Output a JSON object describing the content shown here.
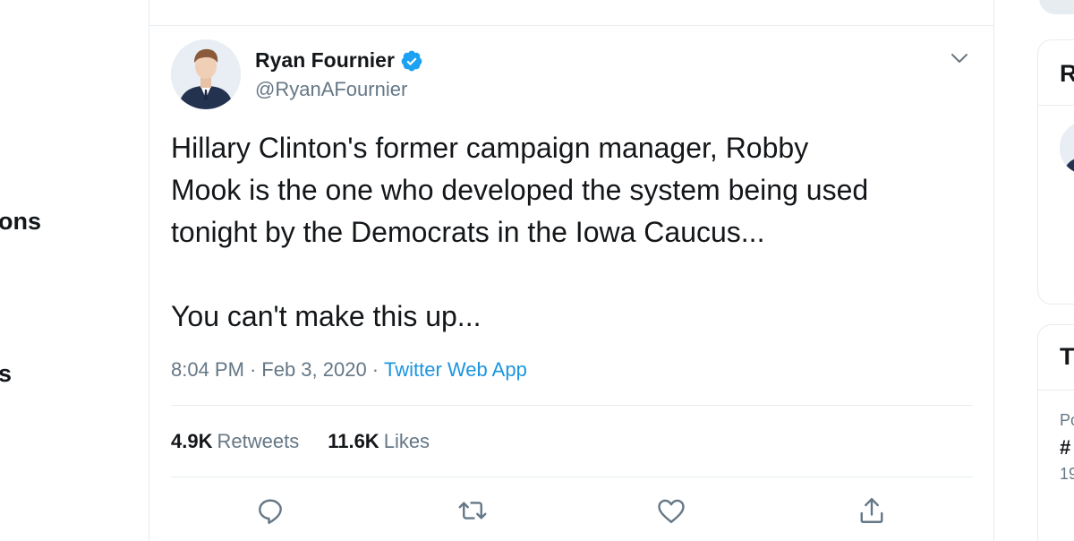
{
  "left_nav": {
    "items": [
      {
        "label": "ons"
      },
      {
        "label": "s"
      }
    ]
  },
  "tweet": {
    "author_name": "Ryan Fournier",
    "author_handle": "@RyanAFournier",
    "verified": true,
    "text": "Hillary Clinton's former campaign manager, Robby\nMook is the one who developed the system being used\ntonight by the Democrats in the Iowa Caucus...\n\nYou can't make this up...",
    "time": "8:04 PM",
    "date": "Feb 3, 2020",
    "separator": "·",
    "source": "Twitter Web App",
    "stats": {
      "retweets_count": "4.9K",
      "retweets_label": "Retweets",
      "likes_count": "11.6K",
      "likes_label": "Likes"
    },
    "actions": [
      "reply-icon",
      "retweet-icon",
      "like-icon",
      "share-icon"
    ]
  },
  "right_sidebar": {
    "card1_title": "R",
    "card2_title": "T",
    "trend_context": "Po",
    "trend_tag": "#",
    "trend_count": "19"
  },
  "colors": {
    "text": "#14171a",
    "secondary": "#657786",
    "link": "#1b95e0",
    "verified": "#1da1f2",
    "border": "#e6ecf0"
  }
}
